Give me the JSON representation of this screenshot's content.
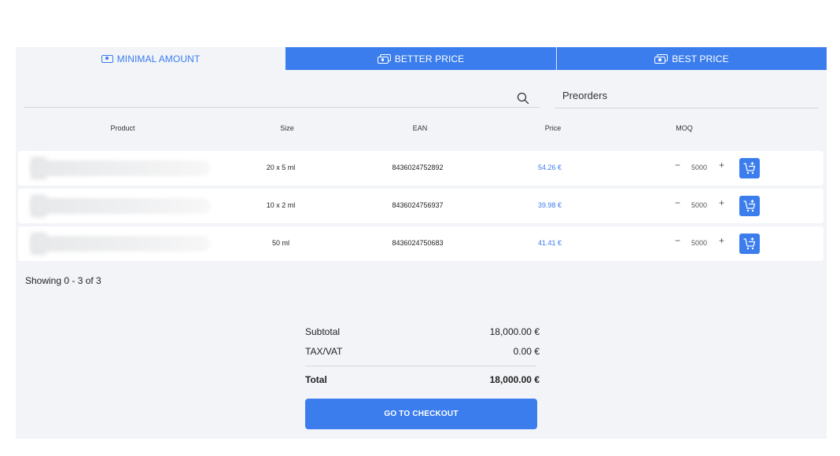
{
  "tabs": {
    "minimal": "MINIMAL AMOUNT",
    "better": "BETTER PRICE",
    "best": "BEST PRICE"
  },
  "search": {
    "preorders_label": "Preorders"
  },
  "columns": {
    "product": "Product",
    "size": "Size",
    "ean": "EAN",
    "price": "Price",
    "moq": "MOQ"
  },
  "rows": [
    {
      "size": "20 x 5 ml",
      "ean": "8436024752892",
      "price": "54.26 €",
      "qty": "5000"
    },
    {
      "size": "10 x 2 ml",
      "ean": "8436024756937",
      "price": "39.98 €",
      "qty": "5000"
    },
    {
      "size": "50 ml",
      "ean": "8436024750683",
      "price": "41.41 €",
      "qty": "5000"
    }
  ],
  "pagination": {
    "showing": "Showing 0 - 3 of 3"
  },
  "summary": {
    "subtotal_label": "Subtotal",
    "subtotal": "18,000.00 €",
    "tax_label": "TAX/VAT",
    "tax": "0.00 €",
    "total_label": "Total",
    "total": "18,000.00 €"
  },
  "checkout_label": "GO TO CHECKOUT",
  "colors": {
    "accent": "#3b7ded",
    "panel": "#f2f4f8"
  },
  "icons": {
    "tab": "money-icon",
    "search": "search-icon",
    "cart": "add-to-cart-icon"
  }
}
